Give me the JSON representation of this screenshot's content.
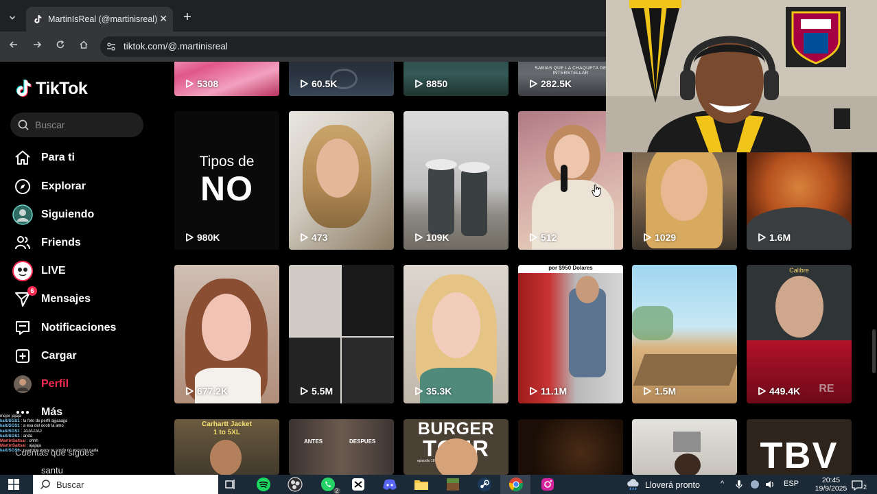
{
  "browser": {
    "tab_title": "MartinIsReal (@martinisreal) | T",
    "url": "tiktok.com/@.martinisreal"
  },
  "sidebar": {
    "logo": "TikTok",
    "search_placeholder": "Buscar",
    "items": [
      {
        "label": "Para ti"
      },
      {
        "label": "Explorar"
      },
      {
        "label": "Siguiendo"
      },
      {
        "label": "Friends"
      },
      {
        "label": "LIVE"
      },
      {
        "label": "Mensajes",
        "badge": "6"
      },
      {
        "label": "Notificaciones"
      },
      {
        "label": "Cargar"
      },
      {
        "label": "Perfil"
      },
      {
        "label": "Más"
      }
    ],
    "following_title": "Cuentas que sigues",
    "following_user": "santu"
  },
  "chat": [
    {
      "user": "",
      "text": "mejor jajaja"
    },
    {
      "user": "kaiUSGS1",
      "text": "la foto de perfil ajjjaaajja"
    },
    {
      "user": "kaiUSGS1",
      "text": "a esa del oooh la amo"
    },
    {
      "user": "kaiUSGS1",
      "text": "JAJAJJAJ"
    },
    {
      "user": "kaiUSGS1",
      "text": "anda"
    },
    {
      "user": "MartinSaltsal",
      "text": "ohhh"
    },
    {
      "user": "MartinSaltsal",
      "text": "ajajaja"
    },
    {
      "user": "kaiUSGS1",
      "text": "paarrrgo estoy re sordo no escucho nada"
    }
  ],
  "videos": {
    "row0": [
      "5308",
      "60.5K",
      "8850",
      "282.5K"
    ],
    "row1": [
      "980K",
      "473",
      "109K",
      "512",
      "1029",
      "1.6M"
    ],
    "row2": [
      "677.2K",
      "5.5M",
      "35.3K",
      "11.1M",
      "1.5M",
      "449.4K"
    ],
    "row0_caption4": "SABIAS QUE LA CHAQUETA DE INTERSTELLAR",
    "row1_title1": "Tipos de",
    "row1_title2": "NO",
    "row2_caption4": "por $950 Dolares",
    "row2_caption6_top": "Calibre",
    "row2_caption6_bottom": "RE",
    "row3_caption1": "Carhartt Jacket",
    "row3_caption1b": "1 to 5XL",
    "row3_caption2a": "ANTES",
    "row3_caption2b": "DESPUES",
    "row3_caption3a": "BURGER",
    "row3_caption3b": "TOUR",
    "row3_caption3c": "episodio 18",
    "row3_caption6": "TBV"
  },
  "taskbar": {
    "search_text": "Buscar",
    "whatsapp_badge": "2",
    "weather": "Lloverá pronto",
    "lang": "ESP",
    "time": "20:45",
    "date": "19/9/2025",
    "notif_count": "2"
  },
  "colors": {
    "tiktok_red": "#fe2c55",
    "tiktok_cyan": "#25f4ee",
    "taskbar": "#1c2a38",
    "chrome_dark": "#202124",
    "chrome_toolbar": "#35363a"
  }
}
